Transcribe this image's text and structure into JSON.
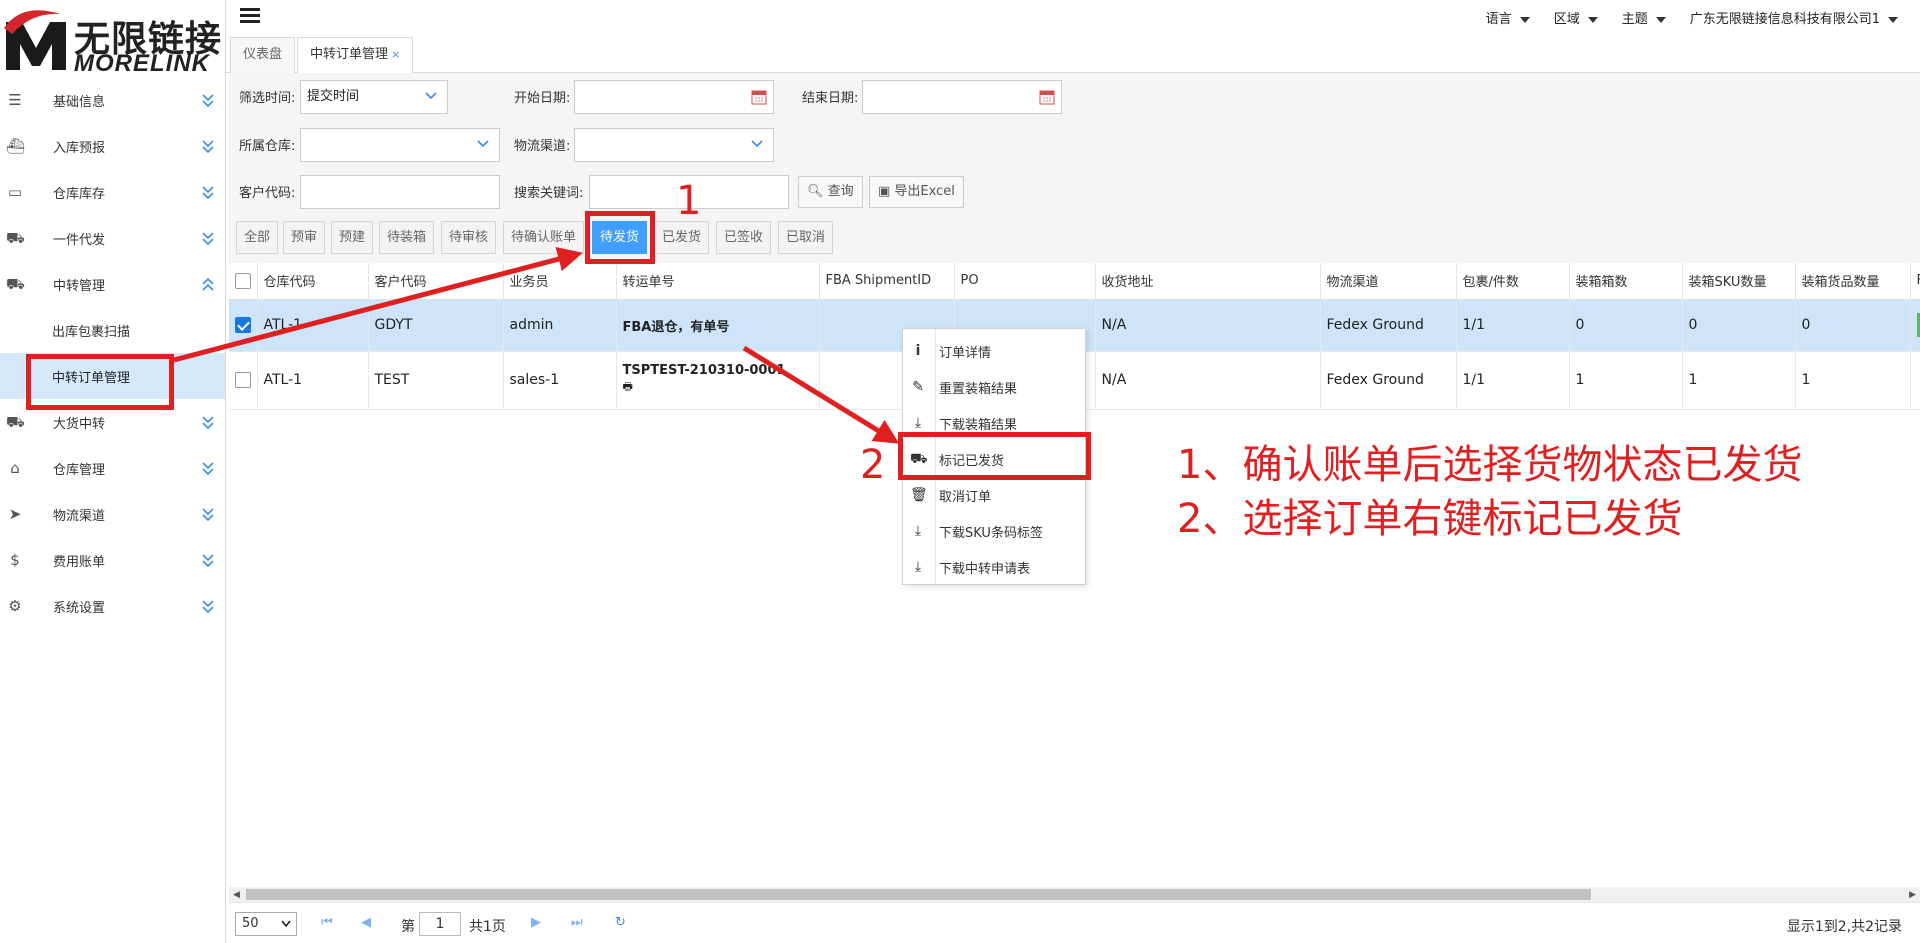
{
  "logo": {
    "cn": "无限链接",
    "en": "MORELINK"
  },
  "sidebar": {
    "items": [
      {
        "label": "基础信息",
        "icon": "list-icon"
      },
      {
        "label": "入库预报",
        "icon": "ship-icon"
      },
      {
        "label": "仓库库存",
        "icon": "inbox-icon"
      },
      {
        "label": "一件代发",
        "icon": "truck-icon"
      },
      {
        "label": "中转管理",
        "icon": "truck-icon",
        "expanded": true
      },
      {
        "label": "出库包裹扫描",
        "sub": true
      },
      {
        "label": "中转订单管理",
        "sub": true,
        "active": true
      },
      {
        "label": "大货中转",
        "icon": "truck-icon"
      },
      {
        "label": "仓库管理",
        "icon": "home-icon"
      },
      {
        "label": "物流渠道",
        "icon": "cursor-icon"
      },
      {
        "label": "费用账单",
        "icon": "dollar-icon"
      },
      {
        "label": "系统设置",
        "icon": "gear-icon"
      }
    ]
  },
  "topbar": {
    "language": "语言",
    "region": "区域",
    "theme": "主题",
    "company": "广东无限链接信息科技有限公司1"
  },
  "tabs": [
    {
      "label": "仪表盘"
    },
    {
      "label": "中转订单管理",
      "close": "×"
    }
  ],
  "filters": {
    "filter_time_label": "筛选时间:",
    "filter_time_value": "提交时间",
    "start_date_label": "开始日期:",
    "end_date_label": "结束日期:",
    "warehouse_label": "所属仓库:",
    "channel_label": "物流渠道:",
    "customer_code_label": "客户代码:",
    "keyword_label": "搜索关键词:",
    "query_button": "查询",
    "export_button": "导出Excel"
  },
  "status_tabs": [
    "全部",
    "预审",
    "预建",
    "待装箱",
    "待审核",
    "待确认账单",
    "待发货",
    "已发货",
    "已签收",
    "已取消"
  ],
  "active_status": "待发货",
  "table": {
    "columns": [
      "仓库代码",
      "客户代码",
      "业务员",
      "转运单号",
      "FBA ShipmentID",
      "PO",
      "收货地址",
      "物流渠道",
      "包裹/件数",
      "装箱箱数",
      "装箱SKU数量",
      "装箱货品数量",
      "Fil"
    ],
    "rows": [
      {
        "checked": true,
        "cells": [
          "ATL-1",
          "GDYT",
          "admin",
          "FBA退仓，有单号",
          "",
          "",
          "N/A",
          "Fedex Ground",
          "1/1",
          "0",
          "0",
          "0",
          ""
        ]
      },
      {
        "checked": false,
        "cells": [
          "ATL-1",
          "TEST",
          "sales-1",
          "TSPTEST-210310-0001",
          "",
          "",
          "N/A",
          "Fedex Ground",
          "1/1",
          "1",
          "1",
          "1",
          ""
        ]
      }
    ]
  },
  "context_menu": [
    {
      "label": "订单详情",
      "icon": "info-icon"
    },
    {
      "label": "重置装箱结果",
      "icon": "edit-icon"
    },
    {
      "label": "下载装箱结果",
      "icon": "download-icon"
    },
    {
      "label": "标记已发货",
      "icon": "truck-icon"
    },
    {
      "label": "取消订单",
      "icon": "trash-icon"
    },
    {
      "label": "下载SKU条码标签",
      "icon": "download-icon"
    },
    {
      "label": "下载中转申请表",
      "icon": "download-icon"
    }
  ],
  "pager": {
    "page_size": "50",
    "page_prefix": "第",
    "page_number": "1",
    "page_total": "共1页",
    "info": "显示1到2,共2记录"
  },
  "annotations": {
    "marker1": "1",
    "marker2": "2",
    "line1": "1、确认账单后选择货物状态已发货",
    "line2": "2、选择订单右键标记已发货"
  },
  "colors": {
    "accent": "#409eff",
    "annotation_red": "#e02020",
    "row_selected": "#cde4fb"
  }
}
